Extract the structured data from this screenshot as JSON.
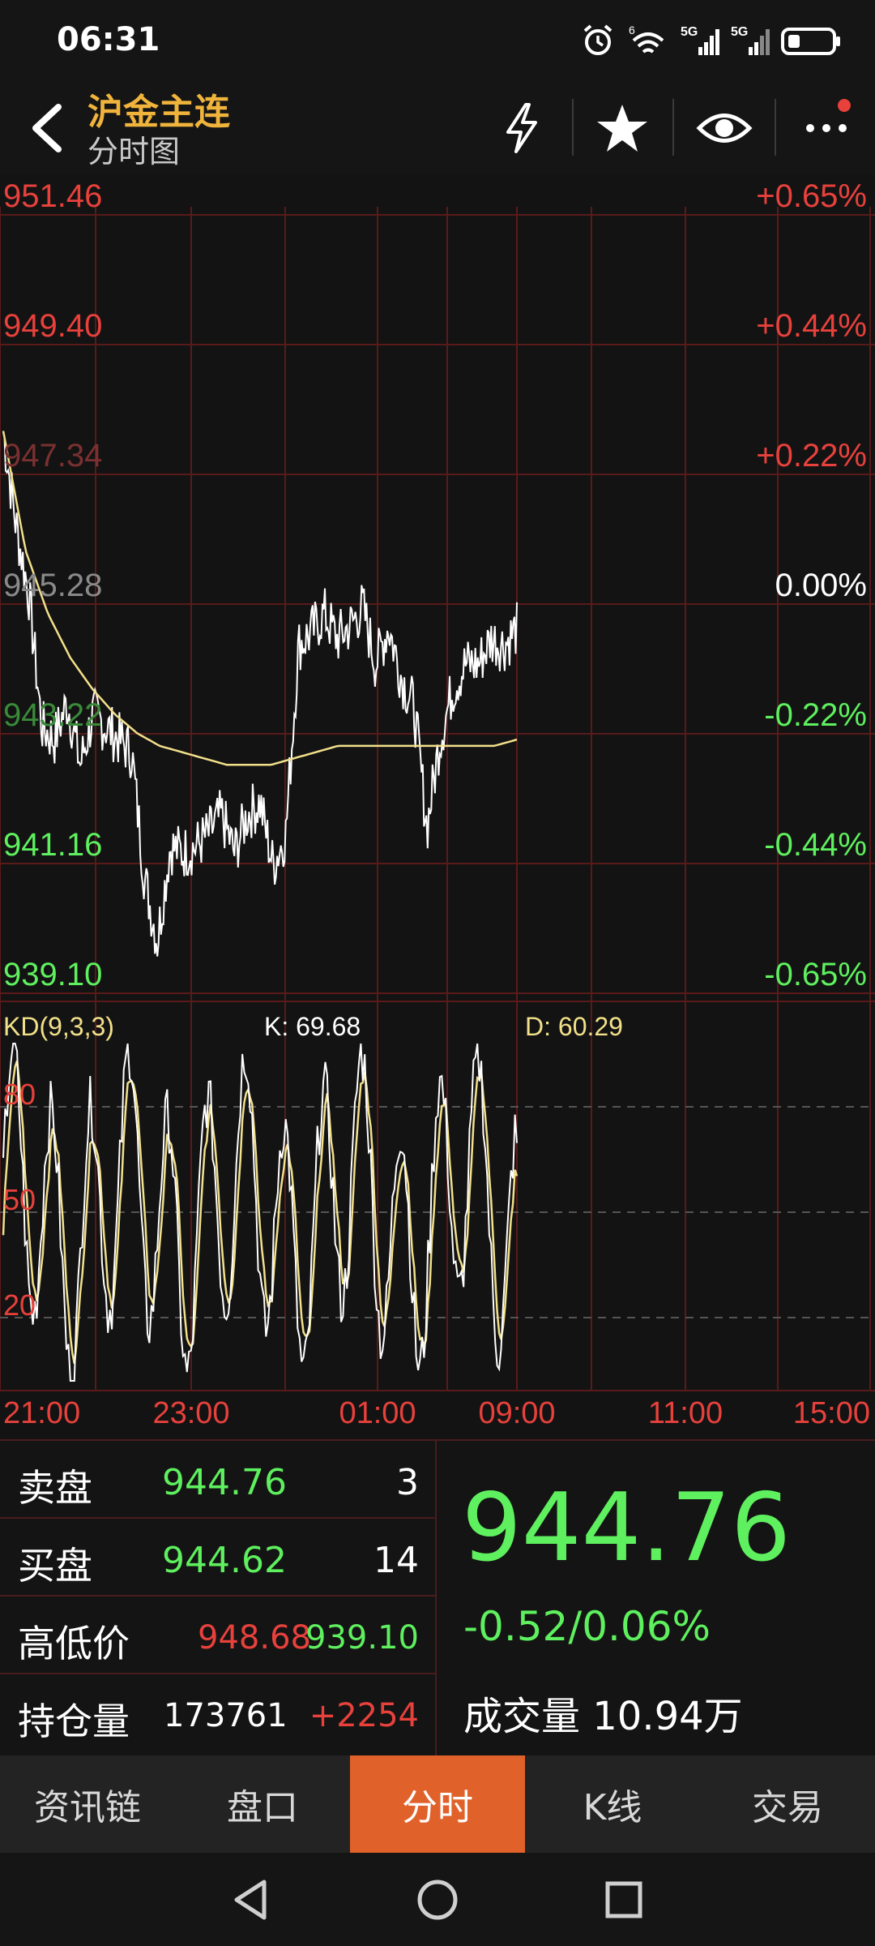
{
  "status": {
    "time": "06:31",
    "net1": "5G",
    "net2": "5G",
    "sup": "6"
  },
  "header": {
    "title": "沪金主连",
    "subtitle": "分时图"
  },
  "chart": {
    "price_labels_left": [
      "951.46",
      "949.40",
      "947.34",
      "945.28",
      "943.22",
      "941.16",
      "939.10"
    ],
    "pct_labels_right": [
      "+0.65%",
      "+0.44%",
      "+0.22%",
      "0.00%",
      "-0.22%",
      "-0.44%",
      "-0.65%"
    ],
    "kd_label": "KD(9,3,3)",
    "k_value": "K: 69.68",
    "d_value": "D: 60.29",
    "kd_levels": [
      "80",
      "50",
      "20"
    ],
    "time_labels": [
      "21:00",
      "23:00",
      "01:00",
      "09:00",
      "11:00",
      "15:00"
    ],
    "colors": {
      "up": "#e8413c",
      "down": "#5ef05e",
      "price_line": "#ffffff",
      "avg_line": "#f2e08a",
      "grid": "#5a1a1a"
    }
  },
  "chart_data": {
    "type": "line",
    "y_range": [
      939.1,
      951.46
    ],
    "pre_settle": 945.28,
    "x_ticks": [
      "21:00",
      "23:00",
      "01:00",
      "09:00",
      "11:00",
      "15:00"
    ],
    "series": [
      {
        "values": [
          947.9,
          946.4,
          945.3,
          943.2,
          943.0,
          943.6,
          942.6,
          943.4,
          943.2,
          943.0,
          942.8,
          940.8,
          939.8,
          941.3,
          941.2,
          941.3,
          941.5,
          941.8,
          941.2,
          941.8,
          942.0,
          941.0,
          941.5,
          944.5,
          944.7,
          945.0,
          944.6,
          944.8,
          945.1,
          944.2,
          944.8,
          944.0,
          943.5,
          941.6,
          943.0,
          943.8,
          944.2,
          944.2,
          944.6,
          944.5,
          944.76
        ]
      },
      {
        "values": [
          947.9,
          946.0,
          945.0,
          944.3,
          943.8,
          943.4,
          943.1,
          942.9,
          942.8,
          942.7,
          942.6,
          942.6,
          942.6,
          942.7,
          942.8,
          942.9,
          942.9,
          942.9,
          942.9,
          942.9,
          942.9,
          942.9,
          942.9,
          943.0
        ]
      }
    ],
    "kd": {
      "k_last": 69.68,
      "d_last": 60.29
    }
  },
  "quote": {
    "sell_label": "卖盘",
    "sell_price": "944.76",
    "sell_vol": "3",
    "buy_label": "买盘",
    "buy_price": "944.62",
    "buy_vol": "14",
    "hilo_label": "高低价",
    "high": "948.68",
    "low": "939.10",
    "oi_label": "持仓量",
    "oi": "173761",
    "oi_change": "+2254",
    "last_price": "944.76",
    "change": "-0.52/0.06%",
    "volume_label": "成交量 10.94万"
  },
  "tabs": [
    {
      "label": "资讯链"
    },
    {
      "label": "盘口"
    },
    {
      "label": "分时",
      "active": true
    },
    {
      "label": "K线"
    },
    {
      "label": "交易"
    }
  ]
}
